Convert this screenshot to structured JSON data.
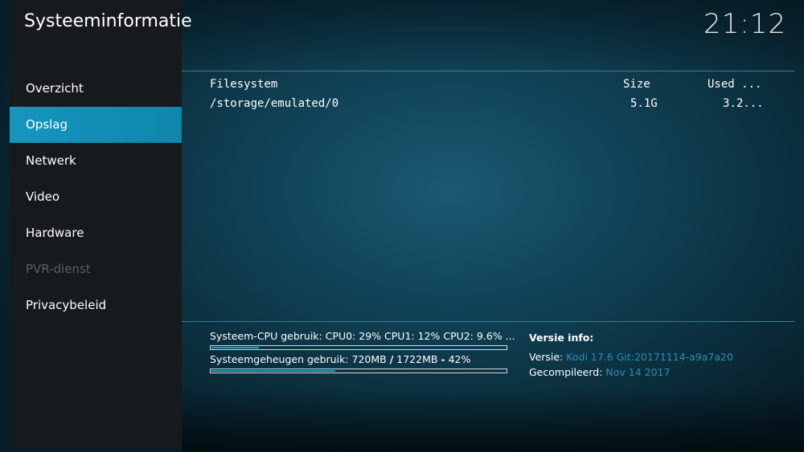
{
  "header": {
    "title": "Systeeminformatie",
    "clock": "21:12"
  },
  "sidebar": {
    "items": [
      {
        "label": "Overzicht",
        "state": "normal"
      },
      {
        "label": "Opslag",
        "state": "selected"
      },
      {
        "label": "Netwerk",
        "state": "normal"
      },
      {
        "label": "Video",
        "state": "normal"
      },
      {
        "label": "Hardware",
        "state": "normal"
      },
      {
        "label": "PVR-dienst",
        "state": "disabled"
      },
      {
        "label": "Privacybeleid",
        "state": "normal"
      }
    ]
  },
  "storage": {
    "headers": {
      "filesystem": "Filesystem",
      "size": "Size",
      "used": "Used ..."
    },
    "rows": [
      {
        "filesystem": "/storage/emulated/0",
        "size": "5.1G",
        "used": "3.2..."
      }
    ]
  },
  "stats": {
    "cpu": {
      "label": "Systeem-CPU gebruik: CPU0:  29% CPU1:  12% CPU2: 9.6% ...",
      "fraction": 0.16
    },
    "memory": {
      "label_prefix": "Systeemgeheugen gebruik: 720MB ",
      "slash": "/",
      "label_mid": " 1722MB ",
      "dash": "-",
      "label_suffix": " 42%",
      "fraction": 0.42
    }
  },
  "version_info": {
    "heading": "Versie info:",
    "version_label": "Versie:",
    "version_value": "Kodi 17.6 Git:20171114-a9a7a20",
    "compiled_label": "Gecompileerd:",
    "compiled_value": "Nov 14 2017"
  },
  "colors": {
    "accent": "#12a0c8",
    "link": "#2a8fb3",
    "sidebar_bg": "#161a1c",
    "disabled_text": "#5b5f61"
  }
}
